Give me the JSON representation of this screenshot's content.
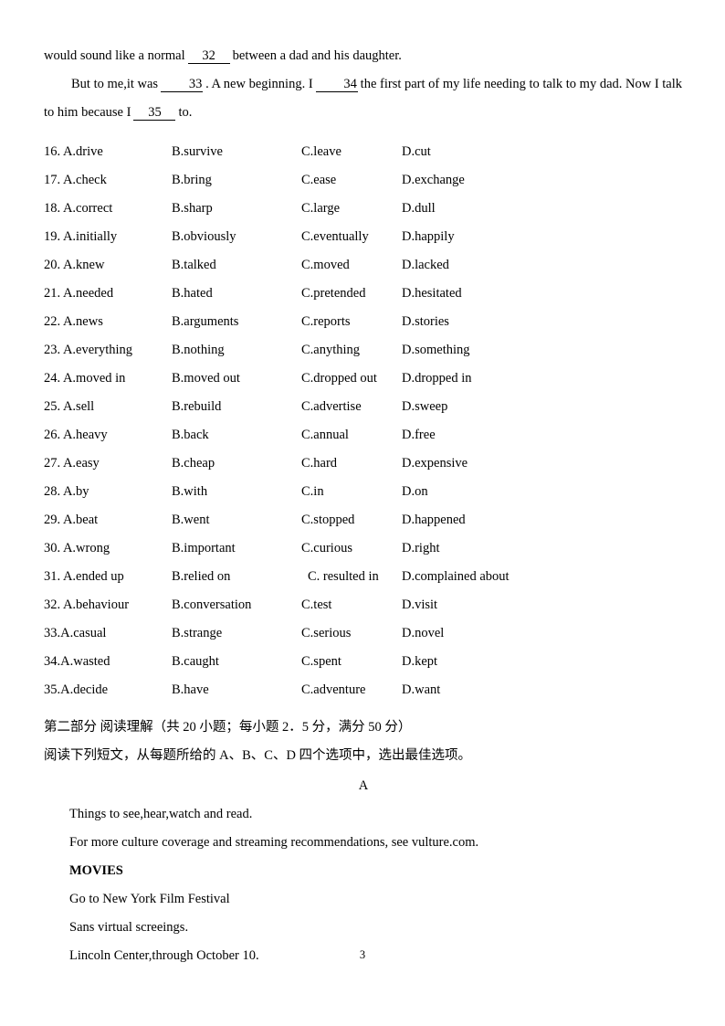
{
  "document": {
    "page_number": "3"
  },
  "cloze_passage": {
    "line1_before": "would sound like a normal",
    "blank_32": "32",
    "line1_after": "between a dad and his daughter.",
    "line2_before": "But to me,it was",
    "blank_33": "33",
    "line2_mid": ". A new beginning. I",
    "blank_34": "34",
    "line2_after": "the first part of my life needing to talk to my dad. Now I talk",
    "line3_before": "to him because I",
    "blank_35": "35",
    "line3_after": "to."
  },
  "options": [
    {
      "a": "16. A.drive",
      "b": "B.survive",
      "c": "C.leave",
      "d": "D.cut"
    },
    {
      "a": "17. A.check",
      "b": "B.bring",
      "c": "C.ease",
      "d": "D.exchange"
    },
    {
      "a": "18. A.correct",
      "b": "B.sharp",
      "c": "C.large",
      "d": "D.dull"
    },
    {
      "a": "19. A.initially",
      "b": "B.obviously",
      "c": "C.eventually",
      "d": "D.happily"
    },
    {
      "a": "20. A.knew",
      "b": "B.talked",
      "c": "C.moved",
      "d": "D.lacked"
    },
    {
      "a": "21. A.needed",
      "b": "B.hated",
      "c": "C.pretended",
      "d": "D.hesitated"
    },
    {
      "a": "22. A.news",
      "b": "B.arguments",
      "c": "C.reports",
      "d": "D.stories"
    },
    {
      "a": "23. A.everything",
      "b": "B.nothing",
      "c": "C.anything",
      "d": "D.something"
    },
    {
      "a": "24. A.moved in",
      "b": "B.moved out",
      "c": "C.dropped out",
      "d": "D.dropped in"
    },
    {
      "a": "25. A.sell",
      "b": "B.rebuild",
      "c": "C.advertise",
      "d": "D.sweep"
    },
    {
      "a": "26. A.heavy",
      "b": "B.back",
      "c": "C.annual",
      "d": "D.free"
    },
    {
      "a": "27. A.easy",
      "b": "B.cheap",
      "c": "C.hard",
      "d": "D.expensive"
    },
    {
      "a": "28. A.by",
      "b": "B.with",
      "c": "C.in",
      "d": "D.on"
    },
    {
      "a": "29. A.beat",
      "b": "B.went",
      "c": "C.stopped",
      "d": "D.happened"
    },
    {
      "a": "30. A.wrong",
      "b": "B.important",
      "c": "C.curious",
      "d": "D.right"
    },
    {
      "a": "31. A.ended up",
      "b": "B.relied on",
      "c": "C. resulted in",
      "d": "D.complained about"
    },
    {
      "a": "32. A.behaviour",
      "b": "B.conversation",
      "c": "C.test",
      "d": "D.visit"
    },
    {
      "a": "33.A.casual",
      "b": "B.strange",
      "c": "C.serious",
      "d": "D.novel"
    },
    {
      "a": "34.A.wasted",
      "b": "B.caught",
      "c": "C.spent",
      "d": "D.kept"
    },
    {
      "a": "35.A.decide",
      "b": "B.have",
      "c": "C.adventure",
      "d": "D.want"
    }
  ],
  "section_two": {
    "heading": "第二部分 阅读理解（共 20 小题；每小题 2．5 分，满分 50 分）",
    "instruction": "阅读下列短文，从每题所给的 A、B、C、D 四个选项中，选出最佳选项。"
  },
  "passage_a": {
    "label": "A",
    "lines": [
      "Things to see,hear,watch and read.",
      "For more culture coverage and streaming recommendations, see vulture.com."
    ],
    "movies_heading": "MOVIES",
    "movies_lines": [
      "Go to New York Film Festival",
      "Sans virtual screeings.",
      "Lincoln Center,through October 10."
    ]
  }
}
